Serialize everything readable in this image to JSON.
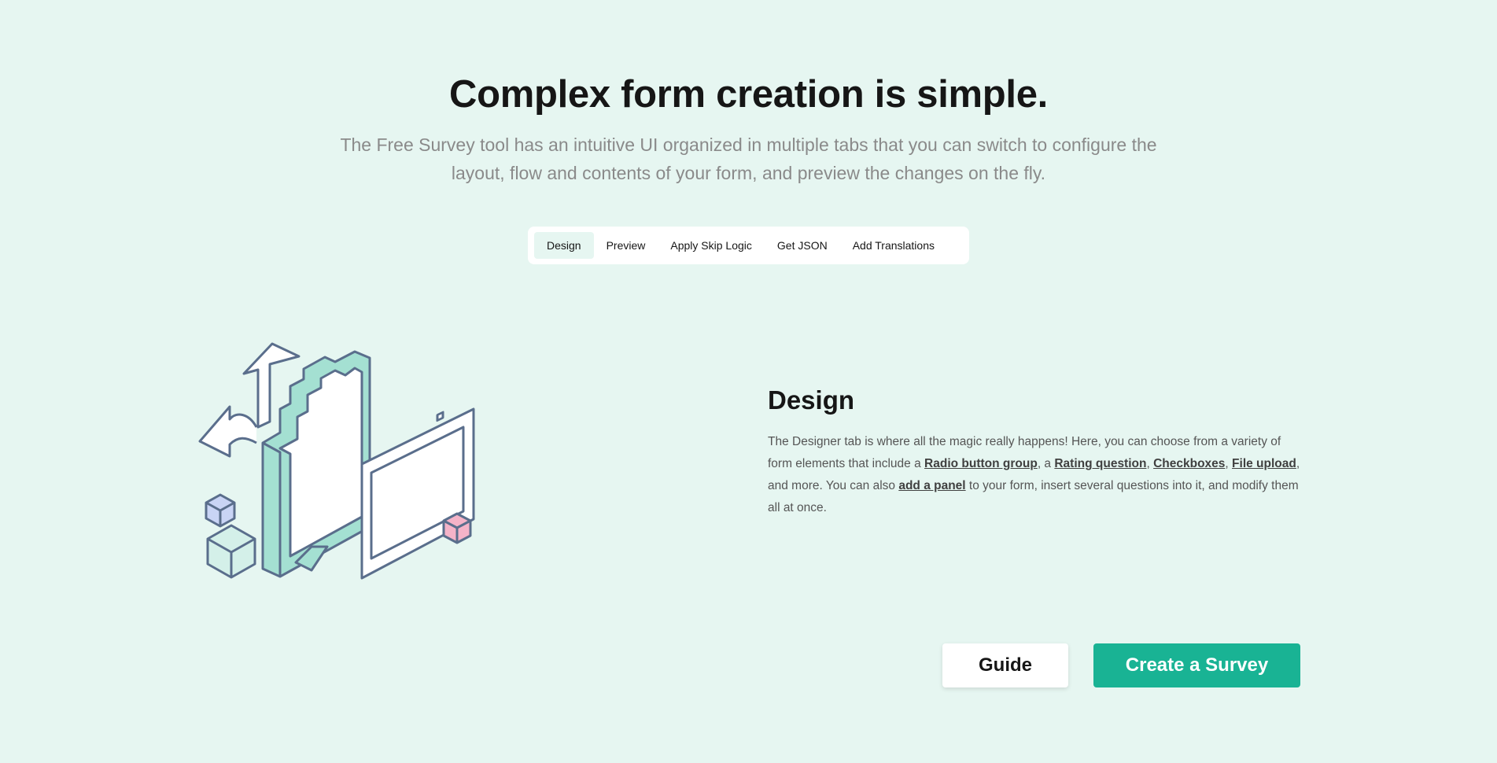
{
  "hero": {
    "title": "Complex form creation is simple.",
    "subtitle": "The Free Survey tool has an intuitive UI organized in multiple tabs that you can switch to configure the layout, flow and contents of your form, and preview the changes on the fly."
  },
  "tabs": [
    {
      "label": "Design",
      "active": true
    },
    {
      "label": "Preview",
      "active": false
    },
    {
      "label": "Apply Skip Logic",
      "active": false
    },
    {
      "label": "Get JSON",
      "active": false
    },
    {
      "label": "Add Translations",
      "active": false
    }
  ],
  "section": {
    "heading": "Design",
    "text_1": "The Designer tab is where all the magic really happens! Here, you can choose from a variety of form elements that include a ",
    "link_radio": "Radio button group",
    "text_2": ", a ",
    "link_rating": "Rating question",
    "text_3": ", ",
    "link_checkboxes": "Checkboxes",
    "text_4": ", ",
    "link_file_upload": "File upload",
    "text_5": ", and more. You can also ",
    "link_panel": "add a panel",
    "text_6": " to your form, insert several questions into it, and modify them all at once."
  },
  "actions": {
    "guide_label": "Guide",
    "create_label": "Create a Survey"
  },
  "colors": {
    "background": "#e6f6f1",
    "accent": "#19b394",
    "illustration_stroke": "#5a6e8c",
    "illustration_fill_mint": "#a4e0d2",
    "illustration_fill_lavender": "#c9d4f5",
    "illustration_fill_pink": "#f5b3c8"
  },
  "illustration": {
    "icon": "form-designer-isometric-icon"
  }
}
